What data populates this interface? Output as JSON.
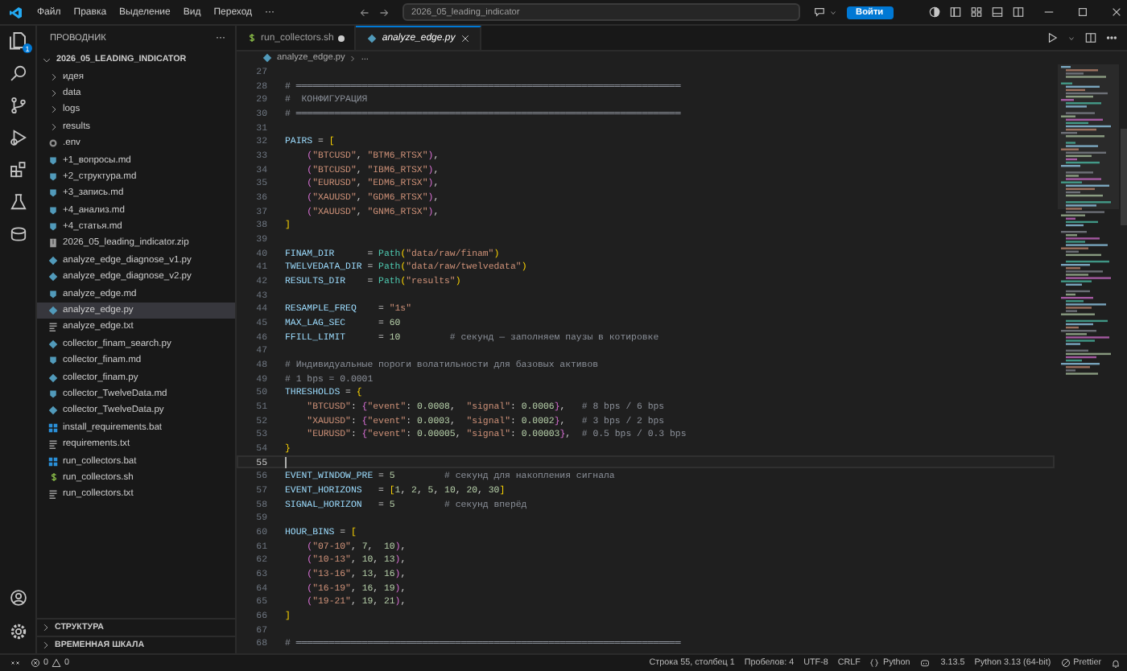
{
  "title_bar": {
    "menus": [
      "Файл",
      "Правка",
      "Выделение",
      "Вид",
      "Переход",
      "···"
    ],
    "search": "2026_05_leading_indicator",
    "sign_in": "Войти"
  },
  "activity_bar": {
    "explorer_badge": "1"
  },
  "explorer": {
    "title": "ПРОВОДНИК",
    "more": "···",
    "root": {
      "label": "2026_05_LEADING_INDICATOR",
      "expanded": true
    },
    "items": [
      {
        "label": "идея",
        "kind": "folder",
        "selected": false
      },
      {
        "label": "data",
        "kind": "folder",
        "selected": false
      },
      {
        "label": "logs",
        "kind": "folder",
        "selected": false
      },
      {
        "label": "results",
        "kind": "folder",
        "selected": false
      },
      {
        "label": ".env",
        "kind": "env",
        "selected": false
      },
      {
        "label": "+1_вопросы.md",
        "kind": "md",
        "selected": false
      },
      {
        "label": "+2_структура.md",
        "kind": "md",
        "selected": false
      },
      {
        "label": "+3_запись.md",
        "kind": "md",
        "selected": false
      },
      {
        "label": "+4_анализ.md",
        "kind": "md",
        "selected": false
      },
      {
        "label": "+4_статья.md",
        "kind": "md",
        "selected": false
      },
      {
        "label": "2026_05_leading_indicator.zip",
        "kind": "zip",
        "selected": false
      },
      {
        "label": "analyze_edge_diagnose_v1.py",
        "kind": "py",
        "selected": false
      },
      {
        "label": "analyze_edge_diagnose_v2.py",
        "kind": "py",
        "selected": false
      },
      {
        "label": "analyze_edge.md",
        "kind": "md",
        "selected": false
      },
      {
        "label": "analyze_edge.py",
        "kind": "py",
        "selected": true
      },
      {
        "label": "analyze_edge.txt",
        "kind": "txt",
        "selected": false
      },
      {
        "label": "collector_finam_search.py",
        "kind": "py",
        "selected": false
      },
      {
        "label": "collector_finam.md",
        "kind": "md",
        "selected": false
      },
      {
        "label": "collector_finam.py",
        "kind": "py",
        "selected": false
      },
      {
        "label": "collector_TwelveData.md",
        "kind": "md",
        "selected": false
      },
      {
        "label": "collector_TwelveData.py",
        "kind": "py",
        "selected": false
      },
      {
        "label": "install_requirements.bat",
        "kind": "bat",
        "selected": false
      },
      {
        "label": "requirements.txt",
        "kind": "txt",
        "selected": false
      },
      {
        "label": "run_collectors.bat",
        "kind": "bat",
        "selected": false
      },
      {
        "label": "run_collectors.sh",
        "kind": "sh",
        "selected": false
      },
      {
        "label": "run_collectors.txt",
        "kind": "txt",
        "selected": false
      }
    ],
    "sections": [
      {
        "label": "СТРУКТУРА",
        "expanded": false
      },
      {
        "label": "ВРЕМЕННАЯ ШКАЛА",
        "expanded": false
      }
    ]
  },
  "tabs": [
    {
      "label": "run_collectors.sh",
      "kind": "sh",
      "selected": false,
      "modified": true,
      "preview": false
    },
    {
      "label": "analyze_edge.py",
      "kind": "py",
      "selected": true,
      "modified": false,
      "preview": true
    }
  ],
  "breadcrumb": [
    "analyze_edge.py",
    "..."
  ],
  "editor": {
    "lines": [
      {
        "n": "27",
        "current": false
      },
      {
        "n": "28",
        "current": false,
        "tokens": [
          {
            "kind": "comment",
            "text": "# ══════════════════════════════════════════════════════════════════════"
          }
        ]
      },
      {
        "n": "29",
        "current": false,
        "tokens": [
          {
            "kind": "comment",
            "text": "#  КОНФИГУРАЦИЯ"
          }
        ]
      },
      {
        "n": "30",
        "current": false,
        "tokens": [
          {
            "kind": "comment",
            "text": "# ══════════════════════════════════════════════════════════════════════"
          }
        ]
      },
      {
        "n": "31",
        "current": false
      },
      {
        "n": "32",
        "current": false,
        "tokens": [
          {
            "kind": "name",
            "text": "PAIRS"
          },
          {
            "kind": "op",
            "text": " = "
          },
          {
            "kind": "b1",
            "text": "["
          }
        ]
      },
      {
        "n": "33",
        "current": false,
        "tokens": [
          {
            "kind": "b2",
            "text": "    ("
          },
          {
            "kind": "str",
            "text": "\"BTCUSD\""
          },
          {
            "kind": "op",
            "text": ", "
          },
          {
            "kind": "str",
            "text": "\"BTM6_RTSX\""
          },
          {
            "kind": "b2",
            "text": ")"
          },
          {
            "kind": "op",
            "text": ","
          }
        ]
      },
      {
        "n": "34",
        "current": false,
        "tokens": [
          {
            "kind": "b2",
            "text": "    ("
          },
          {
            "kind": "str",
            "text": "\"BTCUSD\""
          },
          {
            "kind": "op",
            "text": ", "
          },
          {
            "kind": "str",
            "text": "\"IBM6_RTSX\""
          },
          {
            "kind": "b2",
            "text": ")"
          },
          {
            "kind": "op",
            "text": ","
          }
        ]
      },
      {
        "n": "35",
        "current": false,
        "tokens": [
          {
            "kind": "b2",
            "text": "    ("
          },
          {
            "kind": "str",
            "text": "\"EURUSD\""
          },
          {
            "kind": "op",
            "text": ", "
          },
          {
            "kind": "str",
            "text": "\"EDM6_RTSX\""
          },
          {
            "kind": "b2",
            "text": ")"
          },
          {
            "kind": "op",
            "text": ","
          }
        ]
      },
      {
        "n": "36",
        "current": false,
        "tokens": [
          {
            "kind": "b2",
            "text": "    ("
          },
          {
            "kind": "str",
            "text": "\"XAUUSD\""
          },
          {
            "kind": "op",
            "text": ", "
          },
          {
            "kind": "str",
            "text": "\"GDM6_RTSX\""
          },
          {
            "kind": "b2",
            "text": ")"
          },
          {
            "kind": "op",
            "text": ","
          }
        ]
      },
      {
        "n": "37",
        "current": false,
        "tokens": [
          {
            "kind": "b2",
            "text": "    ("
          },
          {
            "kind": "str",
            "text": "\"XAUUSD\""
          },
          {
            "kind": "op",
            "text": ", "
          },
          {
            "kind": "str",
            "text": "\"GNM6_RTSX\""
          },
          {
            "kind": "b2",
            "text": ")"
          },
          {
            "kind": "op",
            "text": ","
          }
        ]
      },
      {
        "n": "38",
        "current": false,
        "tokens": [
          {
            "kind": "b1",
            "text": "]"
          }
        ]
      },
      {
        "n": "39",
        "current": false
      },
      {
        "n": "40",
        "current": false,
        "tokens": [
          {
            "kind": "name",
            "text": "FINAM_DIR"
          },
          {
            "kind": "op",
            "text": "      = "
          },
          {
            "kind": "func",
            "text": "Path"
          },
          {
            "kind": "b1",
            "text": "("
          },
          {
            "kind": "str",
            "text": "\"data/raw/finam\""
          },
          {
            "kind": "b1",
            "text": ")"
          }
        ]
      },
      {
        "n": "41",
        "current": false,
        "tokens": [
          {
            "kind": "name",
            "text": "TWELVEDATA_DIR"
          },
          {
            "kind": "op",
            "text": " = "
          },
          {
            "kind": "func",
            "text": "Path"
          },
          {
            "kind": "b1",
            "text": "("
          },
          {
            "kind": "str",
            "text": "\"data/raw/twelvedata\""
          },
          {
            "kind": "b1",
            "text": ")"
          }
        ]
      },
      {
        "n": "42",
        "current": false,
        "tokens": [
          {
            "kind": "name",
            "text": "RESULTS_DIR"
          },
          {
            "kind": "op",
            "text": "    = "
          },
          {
            "kind": "func",
            "text": "Path"
          },
          {
            "kind": "b1",
            "text": "("
          },
          {
            "kind": "str",
            "text": "\"results\""
          },
          {
            "kind": "b1",
            "text": ")"
          }
        ]
      },
      {
        "n": "43",
        "current": false
      },
      {
        "n": "44",
        "current": false,
        "tokens": [
          {
            "kind": "name",
            "text": "RESAMPLE_FREQ"
          },
          {
            "kind": "op",
            "text": "    = "
          },
          {
            "kind": "str",
            "text": "\"1s\""
          }
        ]
      },
      {
        "n": "45",
        "current": false,
        "tokens": [
          {
            "kind": "name",
            "text": "MAX_LAG_SEC"
          },
          {
            "kind": "op",
            "text": "      = "
          },
          {
            "kind": "num",
            "text": "60"
          }
        ]
      },
      {
        "n": "46",
        "current": false,
        "tokens": [
          {
            "kind": "name",
            "text": "FFILL_LIMIT"
          },
          {
            "kind": "op",
            "text": "      = "
          },
          {
            "kind": "num",
            "text": "10"
          },
          {
            "kind": "comment",
            "text": "         # секунд — заполняем паузы в котировке"
          }
        ]
      },
      {
        "n": "47",
        "current": false
      },
      {
        "n": "48",
        "current": false,
        "tokens": [
          {
            "kind": "comment",
            "text": "# Индивидуальные пороги волатильности для базовых активов"
          }
        ]
      },
      {
        "n": "49",
        "current": false,
        "tokens": [
          {
            "kind": "comment",
            "text": "# 1 bps = 0.0001"
          }
        ]
      },
      {
        "n": "50",
        "current": false,
        "tokens": [
          {
            "kind": "name",
            "text": "THRESHOLDS"
          },
          {
            "kind": "op",
            "text": " = "
          },
          {
            "kind": "b1",
            "text": "{"
          }
        ]
      },
      {
        "n": "51",
        "current": false,
        "tokens": [
          {
            "kind": "str",
            "text": "    \"BTCUSD\""
          },
          {
            "kind": "op",
            "text": ": "
          },
          {
            "kind": "b2",
            "text": "{"
          },
          {
            "kind": "str",
            "text": "\"event\""
          },
          {
            "kind": "op",
            "text": ": "
          },
          {
            "kind": "num",
            "text": "0.0008"
          },
          {
            "kind": "op",
            "text": ",  "
          },
          {
            "kind": "str",
            "text": "\"signal\""
          },
          {
            "kind": "op",
            "text": ": "
          },
          {
            "kind": "num",
            "text": "0.0006"
          },
          {
            "kind": "b2",
            "text": "}"
          },
          {
            "kind": "op",
            "text": ","
          },
          {
            "kind": "comment",
            "text": "   # 8 bps / 6 bps"
          }
        ]
      },
      {
        "n": "52",
        "current": false,
        "tokens": [
          {
            "kind": "str",
            "text": "    \"XAUUSD\""
          },
          {
            "kind": "op",
            "text": ": "
          },
          {
            "kind": "b2",
            "text": "{"
          },
          {
            "kind": "str",
            "text": "\"event\""
          },
          {
            "kind": "op",
            "text": ": "
          },
          {
            "kind": "num",
            "text": "0.0003"
          },
          {
            "kind": "op",
            "text": ",  "
          },
          {
            "kind": "str",
            "text": "\"signal\""
          },
          {
            "kind": "op",
            "text": ": "
          },
          {
            "kind": "num",
            "text": "0.0002"
          },
          {
            "kind": "b2",
            "text": "}"
          },
          {
            "kind": "op",
            "text": ","
          },
          {
            "kind": "comment",
            "text": "   # 3 bps / 2 bps"
          }
        ]
      },
      {
        "n": "53",
        "current": false,
        "tokens": [
          {
            "kind": "str",
            "text": "    \"EURUSD\""
          },
          {
            "kind": "op",
            "text": ": "
          },
          {
            "kind": "b2",
            "text": "{"
          },
          {
            "kind": "str",
            "text": "\"event\""
          },
          {
            "kind": "op",
            "text": ": "
          },
          {
            "kind": "num",
            "text": "0.00005"
          },
          {
            "kind": "op",
            "text": ", "
          },
          {
            "kind": "str",
            "text": "\"signal\""
          },
          {
            "kind": "op",
            "text": ": "
          },
          {
            "kind": "num",
            "text": "0.00003"
          },
          {
            "kind": "b2",
            "text": "}"
          },
          {
            "kind": "op",
            "text": ","
          },
          {
            "kind": "comment",
            "text": "  # 0.5 bps / 0.3 bps"
          }
        ]
      },
      {
        "n": "54",
        "current": false,
        "tokens": [
          {
            "kind": "b1",
            "text": "}"
          }
        ]
      },
      {
        "n": "55",
        "current": true
      },
      {
        "n": "56",
        "current": false,
        "tokens": [
          {
            "kind": "name",
            "text": "EVENT_WINDOW_PRE"
          },
          {
            "kind": "op",
            "text": " = "
          },
          {
            "kind": "num",
            "text": "5"
          },
          {
            "kind": "comment",
            "text": "         # секунд для накопления сигнала"
          }
        ]
      },
      {
        "n": "57",
        "current": false,
        "tokens": [
          {
            "kind": "name",
            "text": "EVENT_HORIZONS"
          },
          {
            "kind": "op",
            "text": "   = "
          },
          {
            "kind": "b1",
            "text": "["
          },
          {
            "kind": "num",
            "text": "1"
          },
          {
            "kind": "op",
            "text": ", "
          },
          {
            "kind": "num",
            "text": "2"
          },
          {
            "kind": "op",
            "text": ", "
          },
          {
            "kind": "num",
            "text": "5"
          },
          {
            "kind": "op",
            "text": ", "
          },
          {
            "kind": "num",
            "text": "10"
          },
          {
            "kind": "op",
            "text": ", "
          },
          {
            "kind": "num",
            "text": "20"
          },
          {
            "kind": "op",
            "text": ", "
          },
          {
            "kind": "num",
            "text": "30"
          },
          {
            "kind": "b1",
            "text": "]"
          }
        ]
      },
      {
        "n": "58",
        "current": false,
        "tokens": [
          {
            "kind": "name",
            "text": "SIGNAL_HORIZON"
          },
          {
            "kind": "op",
            "text": "   = "
          },
          {
            "kind": "num",
            "text": "5"
          },
          {
            "kind": "comment",
            "text": "         # секунд вперёд"
          }
        ]
      },
      {
        "n": "59",
        "current": false
      },
      {
        "n": "60",
        "current": false,
        "tokens": [
          {
            "kind": "name",
            "text": "HOUR_BINS"
          },
          {
            "kind": "op",
            "text": " = "
          },
          {
            "kind": "b1",
            "text": "["
          }
        ]
      },
      {
        "n": "61",
        "current": false,
        "tokens": [
          {
            "kind": "b2",
            "text": "    ("
          },
          {
            "kind": "str",
            "text": "\"07-10\""
          },
          {
            "kind": "op",
            "text": ", "
          },
          {
            "kind": "num",
            "text": "7"
          },
          {
            "kind": "op",
            "text": ",  "
          },
          {
            "kind": "num",
            "text": "10"
          },
          {
            "kind": "b2",
            "text": ")"
          },
          {
            "kind": "op",
            "text": ","
          }
        ]
      },
      {
        "n": "62",
        "current": false,
        "tokens": [
          {
            "kind": "b2",
            "text": "    ("
          },
          {
            "kind": "str",
            "text": "\"10-13\""
          },
          {
            "kind": "op",
            "text": ", "
          },
          {
            "kind": "num",
            "text": "10"
          },
          {
            "kind": "op",
            "text": ", "
          },
          {
            "kind": "num",
            "text": "13"
          },
          {
            "kind": "b2",
            "text": ")"
          },
          {
            "kind": "op",
            "text": ","
          }
        ]
      },
      {
        "n": "63",
        "current": false,
        "tokens": [
          {
            "kind": "b2",
            "text": "    ("
          },
          {
            "kind": "str",
            "text": "\"13-16\""
          },
          {
            "kind": "op",
            "text": ", "
          },
          {
            "kind": "num",
            "text": "13"
          },
          {
            "kind": "op",
            "text": ", "
          },
          {
            "kind": "num",
            "text": "16"
          },
          {
            "kind": "b2",
            "text": ")"
          },
          {
            "kind": "op",
            "text": ","
          }
        ]
      },
      {
        "n": "64",
        "current": false,
        "tokens": [
          {
            "kind": "b2",
            "text": "    ("
          },
          {
            "kind": "str",
            "text": "\"16-19\""
          },
          {
            "kind": "op",
            "text": ", "
          },
          {
            "kind": "num",
            "text": "16"
          },
          {
            "kind": "op",
            "text": ", "
          },
          {
            "kind": "num",
            "text": "19"
          },
          {
            "kind": "b2",
            "text": ")"
          },
          {
            "kind": "op",
            "text": ","
          }
        ]
      },
      {
        "n": "65",
        "current": false,
        "tokens": [
          {
            "kind": "b2",
            "text": "    ("
          },
          {
            "kind": "str",
            "text": "\"19-21\""
          },
          {
            "kind": "op",
            "text": ", "
          },
          {
            "kind": "num",
            "text": "19"
          },
          {
            "kind": "op",
            "text": ", "
          },
          {
            "kind": "num",
            "text": "21"
          },
          {
            "kind": "b2",
            "text": ")"
          },
          {
            "kind": "op",
            "text": ","
          }
        ]
      },
      {
        "n": "66",
        "current": false,
        "tokens": [
          {
            "kind": "b1",
            "text": "]"
          }
        ]
      },
      {
        "n": "67",
        "current": false
      },
      {
        "n": "68",
        "current": false,
        "tokens": [
          {
            "kind": "comment",
            "text": "# ══════════════════════════════════════════════════════════════════════"
          }
        ]
      }
    ]
  },
  "status_bar": {
    "errors": "0",
    "warnings": "0",
    "items": [
      {
        "kind": "text",
        "text": "Строка 55, столбец 1"
      },
      {
        "kind": "text",
        "text": "Пробелов: 4"
      },
      {
        "kind": "text",
        "text": "UTF-8"
      },
      {
        "kind": "text",
        "text": "CRLF"
      },
      {
        "kind": "braces",
        "text": "Python"
      },
      {
        "kind": "copilot"
      },
      {
        "kind": "text",
        "text": "3.13.5"
      },
      {
        "kind": "text",
        "text": "Python 3.13 (64-bit)"
      },
      {
        "kind": "blocked",
        "text": "Prettier"
      },
      {
        "kind": "bell"
      }
    ]
  }
}
